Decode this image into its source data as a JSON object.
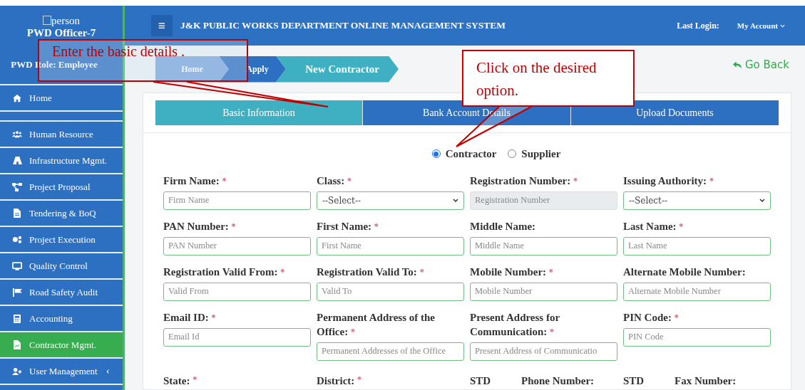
{
  "sidebar": {
    "user_icon_text": "person",
    "user": "PWD Officer-7",
    "role": "PWD Role: Employee",
    "items": [
      {
        "label": "Home",
        "selected": false
      },
      {
        "label": "Human Resource",
        "selected": false
      },
      {
        "label": "Infrastructure Mgmt.",
        "selected": false
      },
      {
        "label": "Project Proposal",
        "selected": false
      },
      {
        "label": "Tendering & BoQ",
        "selected": false
      },
      {
        "label": "Project Execution",
        "selected": false
      },
      {
        "label": "Quality Control",
        "selected": false
      },
      {
        "label": "Road Safety Audit",
        "selected": false
      },
      {
        "label": "Accounting",
        "selected": false
      },
      {
        "label": "Contractor Mgmt.",
        "selected": true
      },
      {
        "label": "User Management",
        "selected": false,
        "expander": "‹"
      }
    ]
  },
  "header": {
    "menu_glyph": "≡",
    "title": "J&K PUBLIC WORKS DEPARTMENT ONLINE MANAGEMENT SYSTEM",
    "last_login": "Last Login:",
    "account": "My Account"
  },
  "breadcrumb": [
    "Home",
    "Apply",
    "New Contractor"
  ],
  "go_back": "Go Back",
  "tabs": [
    {
      "label": "Basic Information",
      "selected": true
    },
    {
      "label": "Bank Account Details",
      "selected": false
    },
    {
      "label": "Upload Documents",
      "selected": false
    }
  ],
  "type_options": [
    {
      "label": "Contractor",
      "selected": true
    },
    {
      "label": "Supplier",
      "selected": false
    }
  ],
  "form_rows": [
    [
      {
        "label": "Firm Name:",
        "required_mark": "*",
        "kind": "text",
        "placeholder": "Firm Name"
      },
      {
        "label": "Class:",
        "required_mark": "*",
        "kind": "select",
        "value": "--Select--"
      },
      {
        "label": "Registration Number:",
        "required_mark": "*",
        "kind": "text",
        "placeholder": "Registration Number",
        "disabled": true
      },
      {
        "label": "Issuing Authority:",
        "required_mark": "*",
        "kind": "select",
        "value": "--Select--"
      }
    ],
    [
      {
        "label": "PAN Number:",
        "required_mark": "*",
        "kind": "text",
        "placeholder": "PAN Number"
      },
      {
        "label": "First Name:",
        "required_mark": "*",
        "kind": "text",
        "placeholder": "First Name"
      },
      {
        "label": "Middle Name:",
        "kind": "text",
        "placeholder": "Middle Name"
      },
      {
        "label": "Last Name:",
        "required_mark": "*",
        "kind": "text",
        "placeholder": "Last Name"
      }
    ],
    [
      {
        "label": "Registration Valid From:",
        "required_mark": "*",
        "kind": "text",
        "placeholder": "Valid From"
      },
      {
        "label": "Registration Valid To:",
        "required_mark": "*",
        "kind": "text",
        "placeholder": "Valid To"
      },
      {
        "label": "Mobile Number:",
        "required_mark": "*",
        "kind": "text",
        "placeholder": "Mobile Number"
      },
      {
        "label": "Alternate Mobile Number:",
        "kind": "text",
        "placeholder": "Alternate Mobile Number"
      }
    ],
    [
      {
        "label": "Email ID:",
        "required_mark": "*",
        "kind": "text",
        "placeholder": "Email Id"
      },
      {
        "label": "Permanent Address of the Office:",
        "required_mark": "*",
        "kind": "text",
        "placeholder": "Permanent Addresses of the Office"
      },
      {
        "label": "Present Address for Communication:",
        "required_mark": "*",
        "kind": "text",
        "placeholder": "Present Address of Communicatio"
      },
      {
        "label": "PIN Code:",
        "required_mark": "*",
        "kind": "text",
        "placeholder": "PIN Code"
      }
    ]
  ],
  "bottom_labels": [
    {
      "label": "State:",
      "required_mark": "*"
    },
    {
      "label": "District:",
      "required_mark": "*"
    },
    {
      "label": "STD"
    },
    {
      "label": "Phone Number:"
    },
    {
      "label": "STD"
    },
    {
      "label": "Fax Number:"
    }
  ],
  "callouts": [
    {
      "text": "Enter the basic details ."
    },
    {
      "text": "Click on the desired option."
    }
  ]
}
